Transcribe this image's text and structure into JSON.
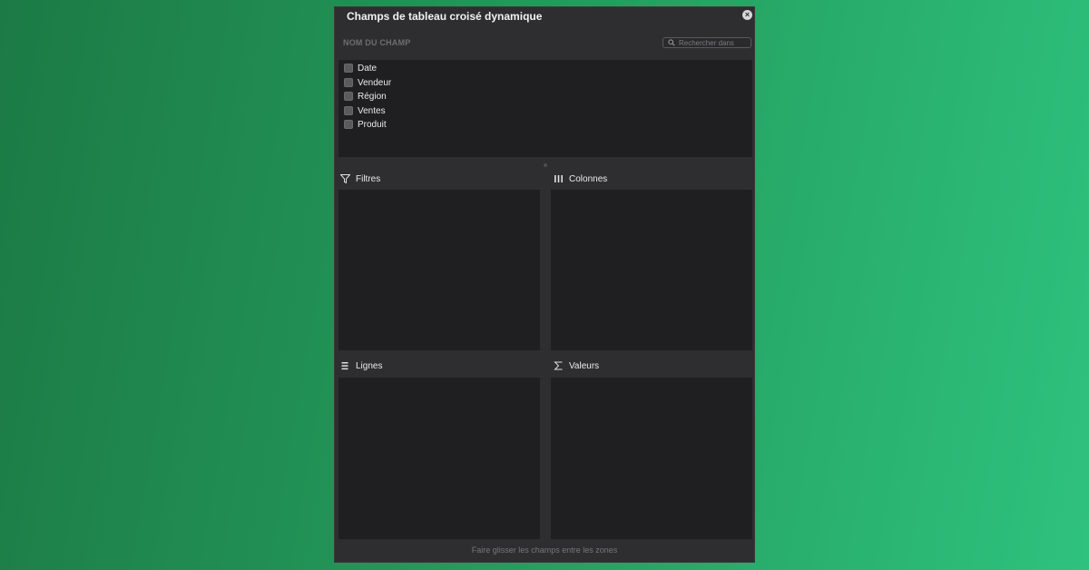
{
  "panel": {
    "title": "Champs de tableau croisé dynamique",
    "close_icon": "close-icon"
  },
  "field_section": {
    "header": "NOM DU CHAMP",
    "search_placeholder": "Rechercher dans",
    "fields": [
      {
        "label": "Date",
        "checked": false
      },
      {
        "label": "Vendeur",
        "checked": false
      },
      {
        "label": "Région",
        "checked": false
      },
      {
        "label": "Ventes",
        "checked": false
      },
      {
        "label": "Produit",
        "checked": false
      }
    ]
  },
  "zones": {
    "filters": {
      "label": "Filtres",
      "icon": "filter-icon"
    },
    "columns": {
      "label": "Colonnes",
      "icon": "columns-icon"
    },
    "rows": {
      "label": "Lignes",
      "icon": "rows-icon"
    },
    "values": {
      "label": "Valeurs",
      "icon": "sigma-icon"
    }
  },
  "footer": {
    "hint": "Faire glisser les champs entre les zones"
  }
}
